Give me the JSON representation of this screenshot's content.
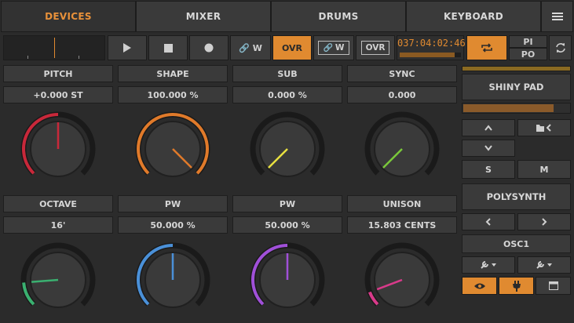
{
  "tabs": [
    {
      "label": "DEVICES",
      "active": true
    },
    {
      "label": "MIXER",
      "active": false
    },
    {
      "label": "DRUMS",
      "active": false
    },
    {
      "label": "KEYBOARD",
      "active": false
    }
  ],
  "menu_icon": "hamburger-icon",
  "transport": {
    "play_icon": "play-icon",
    "stop_icon": "stop-icon",
    "record_icon": "record-icon",
    "link_w_label": "W",
    "ovr_label": "OVR",
    "link_w2_label": "W",
    "ovr2_label": "OVR",
    "time": "037:04:02:46",
    "loop_icon": "loop-icon",
    "pi_label": "PI",
    "po_label": "PO",
    "sync_icon": "refresh-icon"
  },
  "accent_color": "#e08a30",
  "params_row1": [
    {
      "name": "PITCH",
      "value": "+0.000 ST",
      "color": "#c8283a",
      "level": 0.5
    },
    {
      "name": "SHAPE",
      "value": "100.000 %",
      "color": "#e07a2a",
      "level": 1.0
    },
    {
      "name": "SUB",
      "value": "0.000 %",
      "color": "#e8e040",
      "level": 0.0
    },
    {
      "name": "SYNC",
      "value": "0.000",
      "color": "#7ac83a",
      "level": 0.0
    }
  ],
  "params_row2": [
    {
      "name": "OCTAVE",
      "value": "16'",
      "color": "#3ab070",
      "level": 0.15
    },
    {
      "name": "PW",
      "value": "50.000 %",
      "color": "#4a90d8",
      "level": 0.5
    },
    {
      "name": "PW",
      "value": "50.000 %",
      "color": "#a050d8",
      "level": 0.5
    },
    {
      "name": "UNISON",
      "value": "15.803 CENTS",
      "color": "#d83a8a",
      "level": 0.09
    }
  ],
  "side": {
    "preset_name": "SHINY PAD",
    "up_icon": "chevron-up-icon",
    "folder_icon": "folder-back-icon",
    "down_icon": "chevron-down-icon",
    "solo_label": "S",
    "mute_label": "M",
    "device_name": "POLYSYNTH",
    "prev_icon": "chevron-left-icon",
    "next_icon": "chevron-right-icon",
    "page_name": "OSC1",
    "wrench1_icon": "wrench-dropdown-icon",
    "wrench2_icon": "wrench-dropdown-icon",
    "eye_icon": "eye-icon",
    "plug_icon": "plug-icon",
    "window_icon": "window-icon"
  }
}
